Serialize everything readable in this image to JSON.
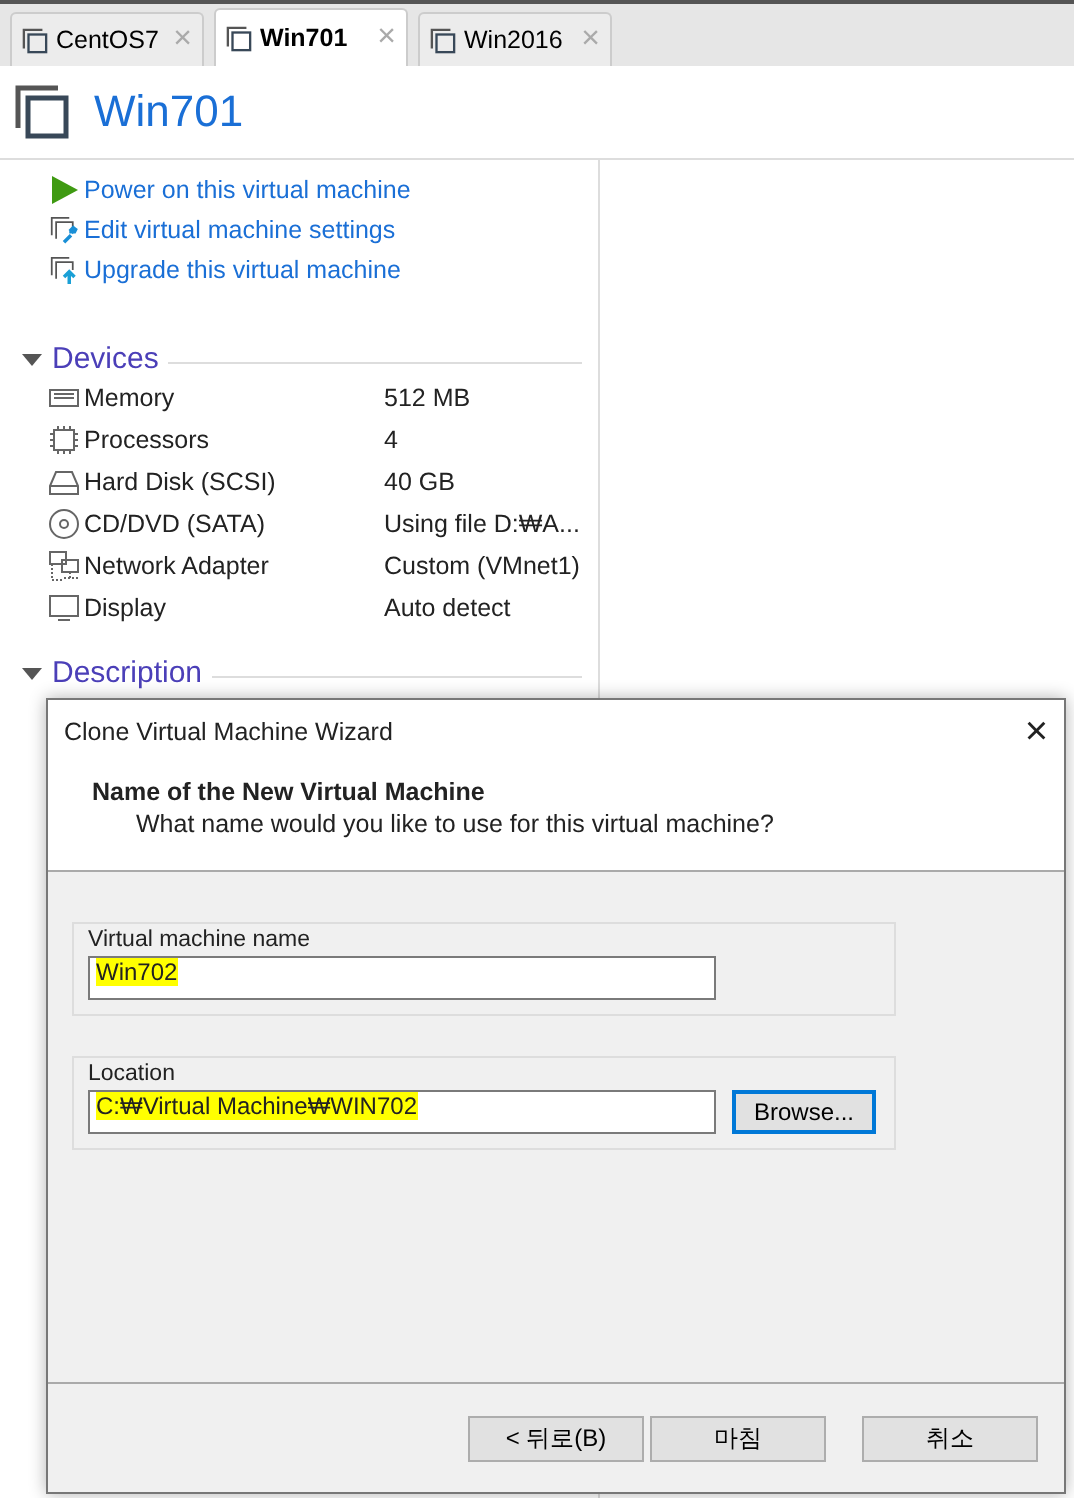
{
  "tabs": [
    {
      "label": "CentOS7",
      "selected": false,
      "close": "×"
    },
    {
      "label": "Win701",
      "selected": true,
      "close": "×"
    },
    {
      "label": "Win2016",
      "selected": false,
      "close": "×"
    }
  ],
  "vm_title": "Win701",
  "actions": [
    {
      "kind": "power",
      "label": "Power on this virtual machine"
    },
    {
      "kind": "settings",
      "label": "Edit virtual machine settings"
    },
    {
      "kind": "upgrade",
      "label": "Upgrade this virtual machine"
    }
  ],
  "devices": {
    "heading": "Devices",
    "expanded": true,
    "items": [
      {
        "kind": "memory",
        "name": "Memory",
        "value": "512 MB"
      },
      {
        "kind": "cpu",
        "name": "Processors",
        "value": "4"
      },
      {
        "kind": "disk",
        "name": "Hard Disk (SCSI)",
        "value": "40 GB"
      },
      {
        "kind": "cd",
        "name": "CD/DVD (SATA)",
        "value": "Using file D:₩A..."
      },
      {
        "kind": "network",
        "name": "Network Adapter",
        "value": "Custom (VMnet1)"
      },
      {
        "kind": "display",
        "name": "Display",
        "value": "Auto detect"
      }
    ]
  },
  "description": {
    "heading": "Description",
    "expanded": true
  },
  "dialog": {
    "title": "Clone Virtual Machine Wizard",
    "close": "×",
    "heading": "Name of the New Virtual Machine",
    "subheading": "What name would you like to use for this virtual machine?",
    "groups": [
      {
        "label": "Virtual machine name",
        "value": "Win702",
        "highlighted": true
      },
      {
        "label": "Location",
        "value": "C:₩Virtual Machine₩WIN702",
        "highlighted": true,
        "button": "Browse..."
      }
    ],
    "buttons": [
      "< 뒤로(B)",
      "마침",
      "취소"
    ]
  }
}
